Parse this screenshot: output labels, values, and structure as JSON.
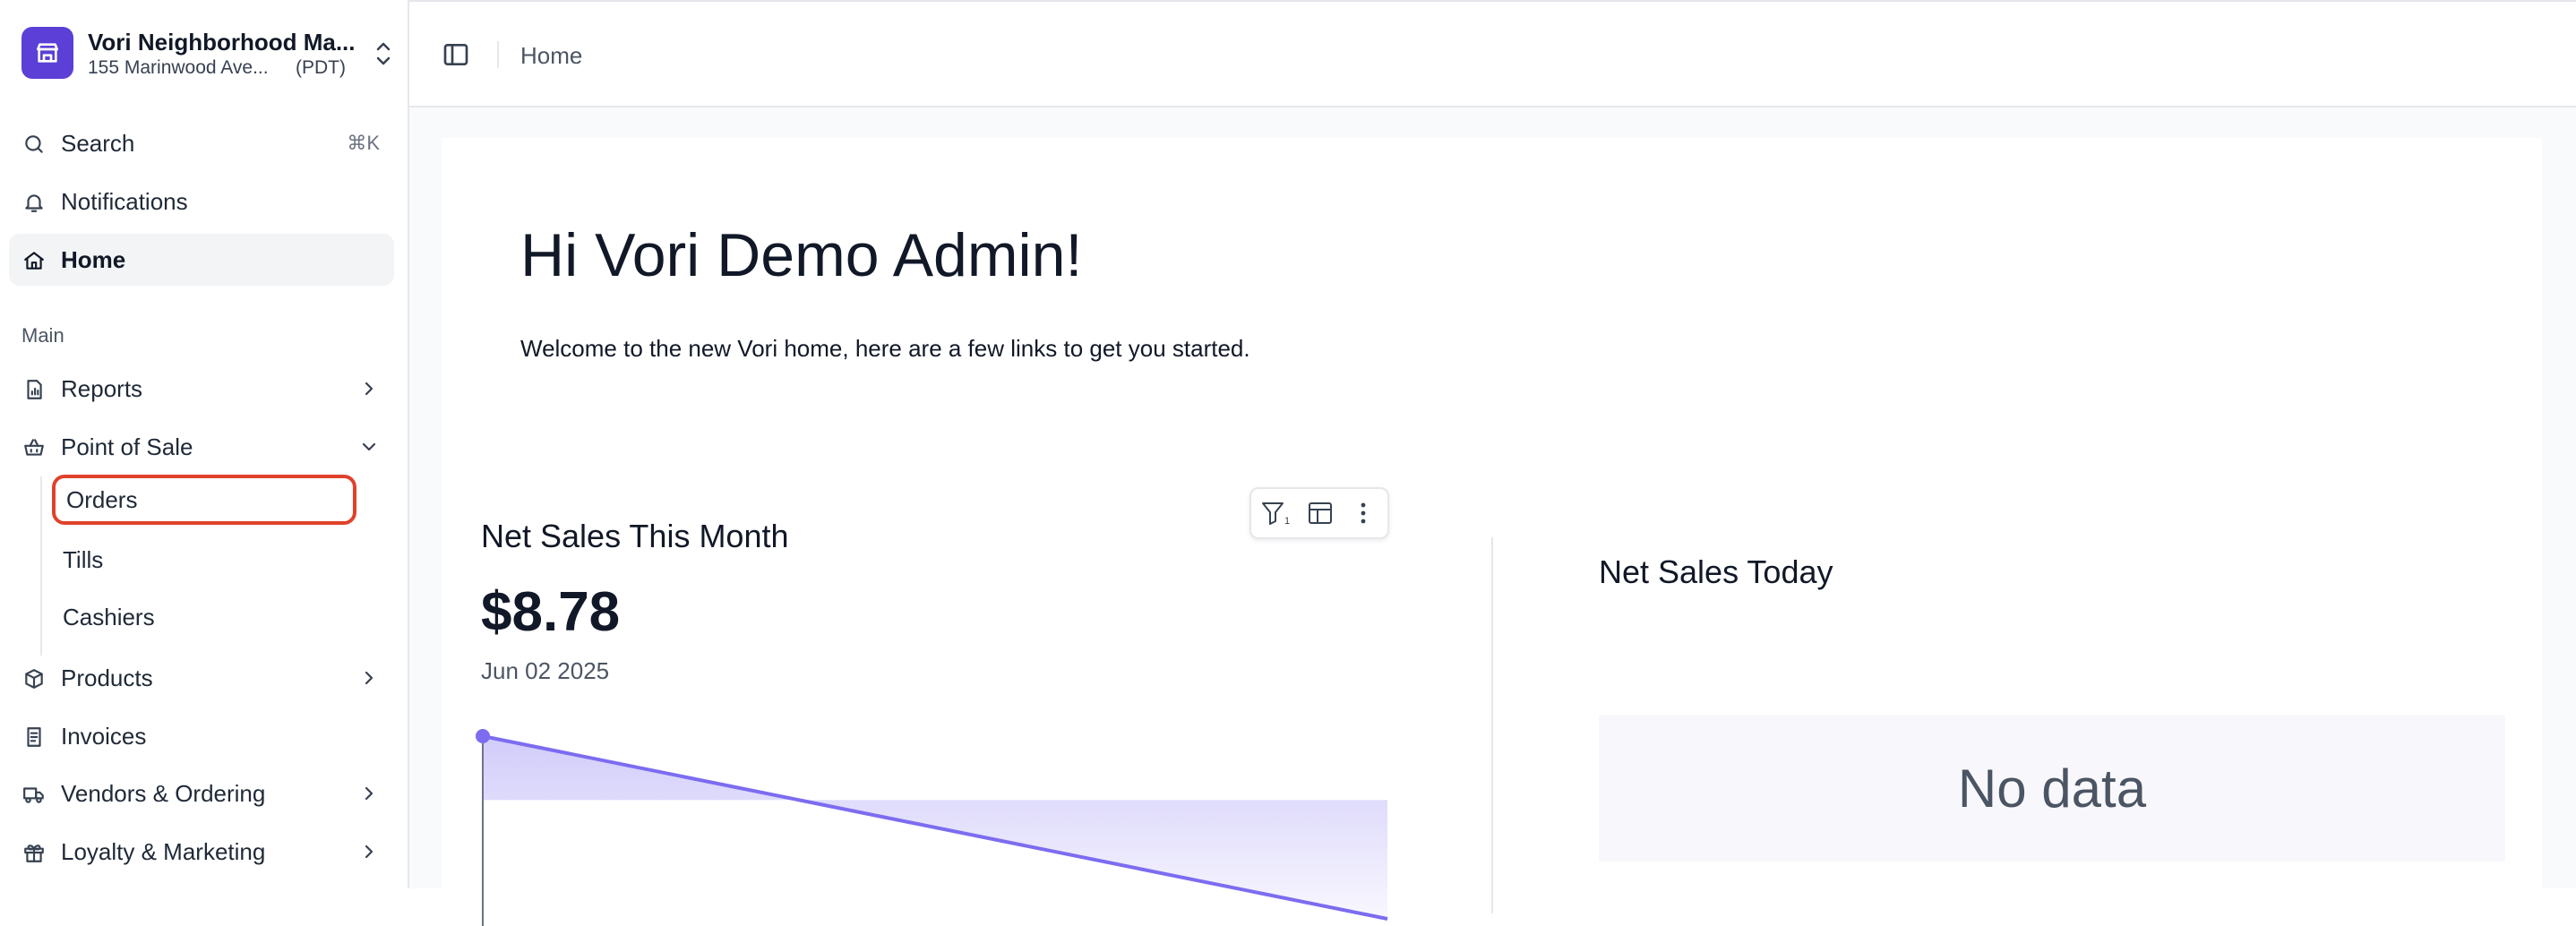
{
  "store": {
    "name": "Vori Neighborhood Ma...",
    "address": "155 Marinwood Ave...",
    "timezone": "(PDT)",
    "logo_icon": "storefront-icon",
    "logo_color": "#5b3fd6"
  },
  "nav": {
    "search_label": "Search",
    "search_shortcut": "⌘K",
    "notifications_label": "Notifications",
    "home_label": "Home",
    "section_main": "Main",
    "reports_label": "Reports",
    "pos_label": "Point of Sale",
    "pos_sub": {
      "orders": "Orders",
      "tills": "Tills",
      "cashiers": "Cashiers"
    },
    "products_label": "Products",
    "invoices_label": "Invoices",
    "vendors_label": "Vendors & Ordering",
    "loyalty_label": "Loyalty & Marketing"
  },
  "header": {
    "breadcrumb": "Home"
  },
  "main": {
    "greeting": "Hi Vori Demo Admin!",
    "welcome": "Welcome to the new Vori home, here are a few links to get you started."
  },
  "tile_month": {
    "title": "Net Sales This Month",
    "value": "$8.78",
    "date": "Jun 02 2025",
    "toolbar": {
      "filter_count": "1"
    }
  },
  "tile_today": {
    "title": "Net Sales Today",
    "empty_text": "No data"
  },
  "chart_data": {
    "type": "area",
    "series": [
      {
        "values": [
          1.0,
          0.0
        ]
      }
    ],
    "color": "#7c6cf0",
    "highlight_point": 0
  },
  "colors": {
    "accent": "#7c6cf0",
    "highlight_ring": "#e0412b"
  }
}
